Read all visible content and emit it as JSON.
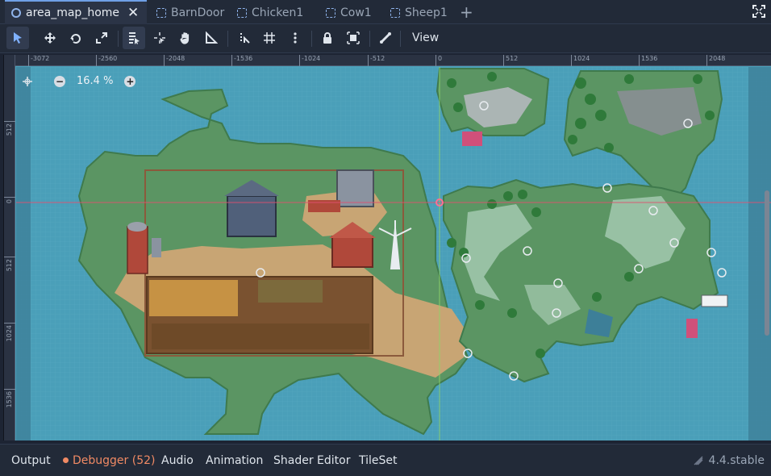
{
  "scene_tabs": [
    {
      "label": "area_map_home",
      "active": true
    },
    {
      "label": "BarnDoor"
    },
    {
      "label": "Chicken1"
    },
    {
      "label": "Cow1"
    },
    {
      "label": "Sheep1"
    }
  ],
  "toolbar": {
    "view_label": "View",
    "tools": [
      "select",
      "move",
      "rotate",
      "scale",
      "list-select",
      "pivot",
      "pan",
      "ruler",
      "smart-snap",
      "grid-snap",
      "more",
      "lock",
      "group",
      "skeleton"
    ]
  },
  "viewport": {
    "zoom_label": "16.4 %",
    "ruler_top": [
      "-3072",
      "-2560",
      "-2048",
      "-1536",
      "-1024",
      "-512",
      "0",
      "512",
      "1024",
      "1536",
      "2048"
    ],
    "ruler_left": [
      "512",
      "0",
      "512",
      "1024",
      "1536"
    ]
  },
  "bottom_panel": {
    "tabs": [
      "Output",
      "Debugger (52)",
      "Audio",
      "Animation",
      "Shader Editor",
      "TileSet"
    ],
    "version": "4.4.stable"
  },
  "colors": {
    "water": "#4a9fb9",
    "grass": "#5b9563",
    "dirt": "#c8a574",
    "accent": "#6fa0e6",
    "warning": "#f08a64"
  }
}
